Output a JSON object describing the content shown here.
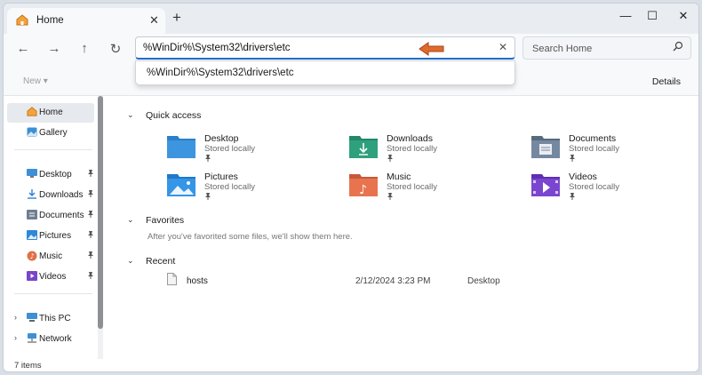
{
  "tab": {
    "title": "Home",
    "close": "✕",
    "new_tab": "+"
  },
  "window_controls": {
    "minimize": "—",
    "maximize": "☐",
    "close": "✕"
  },
  "nav": {
    "back": "←",
    "forward": "→",
    "up": "↑",
    "refresh": "↻"
  },
  "address": {
    "value": "%WinDir%\\System32\\drivers\\etc",
    "clear": "✕"
  },
  "search": {
    "placeholder": "Search Home"
  },
  "suggestion": {
    "text": "%WinDir%\\System32\\drivers\\etc"
  },
  "commandbar": {
    "new_label": "New ▾",
    "details_label": "Details"
  },
  "sidebar": {
    "home": "Home",
    "gallery": "Gallery",
    "pinned": [
      {
        "label": "Desktop",
        "icon": "desktop-icon",
        "color": "#3d8fd6"
      },
      {
        "label": "Downloads",
        "icon": "downloads-icon",
        "color": "#2f9c7a"
      },
      {
        "label": "Documents",
        "icon": "documents-icon",
        "color": "#6e7f93"
      },
      {
        "label": "Pictures",
        "icon": "pictures-icon",
        "color": "#2f88d8"
      },
      {
        "label": "Music",
        "icon": "music-icon",
        "color": "#e07048"
      },
      {
        "label": "Videos",
        "icon": "videos-icon",
        "color": "#7a45c8"
      }
    ],
    "pin_glyph": "📌",
    "this_pc": "This PC",
    "network": "Network"
  },
  "sections": {
    "quick_access": "Quick access",
    "favorites": "Favorites",
    "favorites_note": "After you've favorited some files, we'll show them here.",
    "recent": "Recent"
  },
  "quick_access_items": [
    {
      "name": "Desktop",
      "sub": "Stored locally"
    },
    {
      "name": "Downloads",
      "sub": "Stored locally"
    },
    {
      "name": "Documents",
      "sub": "Stored locally"
    },
    {
      "name": "Pictures",
      "sub": "Stored locally"
    },
    {
      "name": "Music",
      "sub": "Stored locally"
    },
    {
      "name": "Videos",
      "sub": "Stored locally"
    }
  ],
  "recent_files": [
    {
      "name": "hosts",
      "date": "2/12/2024 3:23 PM",
      "location": "Desktop"
    }
  ],
  "status": {
    "items": "7 items"
  },
  "colors": {
    "accent": "#1f6fc8",
    "arrow": "#e06a2c"
  }
}
